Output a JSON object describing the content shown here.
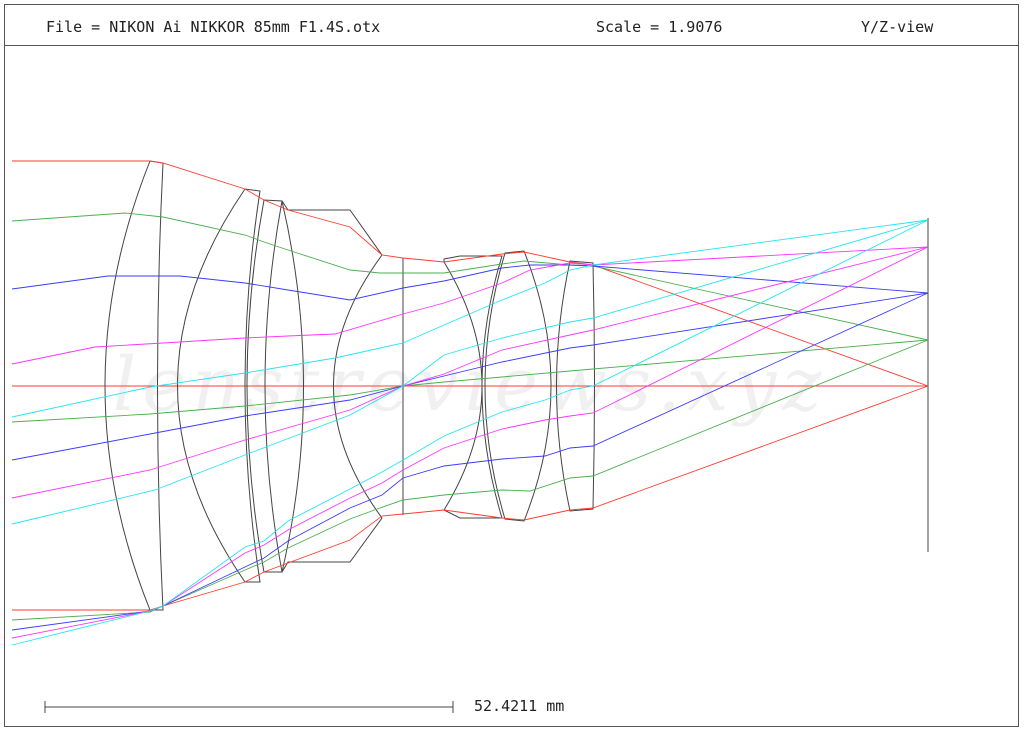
{
  "header": {
    "file": "File = NIKON Ai NIKKOR 85mm F1.4S.otx",
    "scale": "Scale = 1.9076",
    "view": "Y/Z-view"
  },
  "scale_bar": {
    "label": "52.4211 mm"
  },
  "watermark": "lenstreviews.xyz",
  "colors": {
    "frame": "#555555",
    "lens": "#444444",
    "axis": "#ff3333",
    "ray_red": "#ff3b30",
    "ray_green": "#4caf50",
    "ray_blue": "#3b3bff",
    "ray_magenta": "#ff33ff",
    "ray_cyan": "#22e5f0",
    "watermark": "#f2f2f2"
  }
}
